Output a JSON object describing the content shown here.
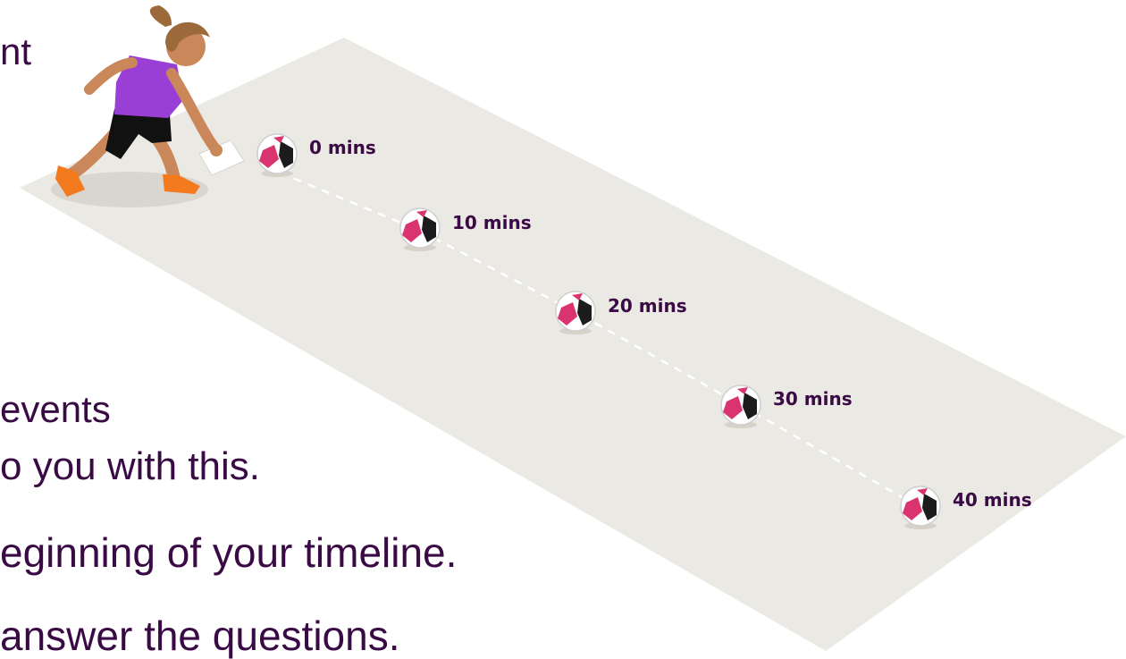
{
  "text_lines": [
    "nt",
    "events",
    "o you with this.",
    "eginning of your timeline.",
    "answer the questions."
  ],
  "markers": [
    {
      "label": "0 mins"
    },
    {
      "label": "10 mins"
    },
    {
      "label": "20 mins"
    },
    {
      "label": "30 mins"
    },
    {
      "label": "40 mins"
    }
  ],
  "colors": {
    "text": "#3a0a45",
    "pitch": "#ebe9e4",
    "shirt": "#9a3fd6",
    "shorts": "#111111",
    "boots": "#f47a1e",
    "ball_accent": "#d9346f"
  },
  "icons": [
    "girl-footballer-illustration",
    "football-icon"
  ]
}
